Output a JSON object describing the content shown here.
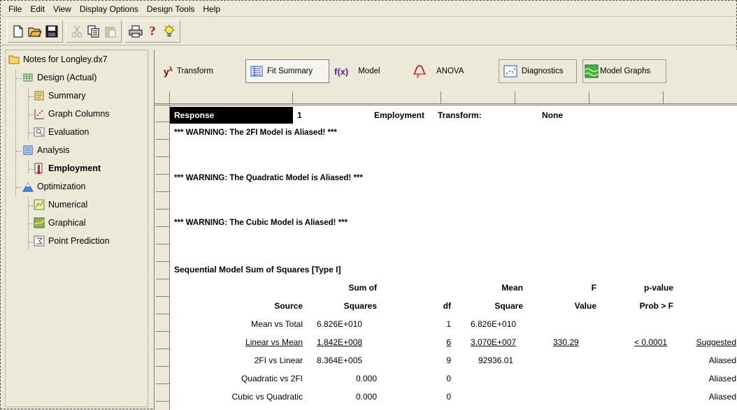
{
  "menu": [
    "File",
    "Edit",
    "View",
    "Display Options",
    "Design Tools",
    "Help"
  ],
  "toolbar": {
    "buttons": [
      "new-icon",
      "open-icon",
      "save-icon",
      "cut-icon",
      "copy-icon",
      "paste-icon",
      "print-icon",
      "help-icon",
      "tip-icon"
    ]
  },
  "tree": {
    "root": "Notes for Longley.dx7",
    "design": "Design (Actual)",
    "summary": "Summary",
    "graph_columns": "Graph Columns",
    "evaluation": "Evaluation",
    "analysis": "Analysis",
    "employment": "Employment",
    "optimization": "Optimization",
    "numerical": "Numerical",
    "graphical": "Graphical",
    "point_prediction": "Point Prediction"
  },
  "tabs": {
    "transform": "Transform",
    "fit_summary": "Fit Summary",
    "model": "Model",
    "anova": "ANOVA",
    "diagnostics": "Diagnostics",
    "model_graphs": "Model Graphs"
  },
  "report": {
    "response_label": "Response",
    "response_num": "1",
    "response_name": "Employment",
    "transform_label": "Transform:",
    "transform_value": "None",
    "warn_2fi": "*** WARNING: The 2FI Model is Aliased! ***",
    "warn_quad": "*** WARNING: The Quadratic Model is Aliased! ***",
    "warn_cubic": "*** WARNING: The Cubic Model is Aliased! ***",
    "section_title": "Sequential Model Sum of Squares [Type I]",
    "headers_top": [
      "",
      "Sum of",
      "",
      "Mean",
      "F",
      "p-value",
      ""
    ],
    "headers_bottom": [
      "Source",
      "Squares",
      "df",
      "Square",
      "Value",
      "Prob > F",
      ""
    ],
    "rows": [
      {
        "source": "Mean vs Total",
        "ss": "6.826E+010",
        "df": "1",
        "ms": "6.826E+010",
        "f": "",
        "p": "",
        "note": ""
      },
      {
        "source": "Linear vs Mean",
        "ss": "1.842E+008",
        "df": "6",
        "ms": "3.070E+007",
        "f": "330.29",
        "p": "< 0.0001",
        "note": "Suggested"
      },
      {
        "source": "2FI vs Linear",
        "ss": "8.364E+005",
        "df": "9",
        "ms": "92936.01",
        "f": "",
        "p": "",
        "note": "Aliased"
      },
      {
        "source": "Quadratic vs 2FI",
        "ss": "0.000",
        "df": "0",
        "ms": "",
        "f": "",
        "p": "",
        "note": "Aliased"
      },
      {
        "source": "Cubic vs Quadratic",
        "ss": "0.000",
        "df": "0",
        "ms": "",
        "f": "",
        "p": "",
        "note": "Aliased"
      }
    ]
  }
}
